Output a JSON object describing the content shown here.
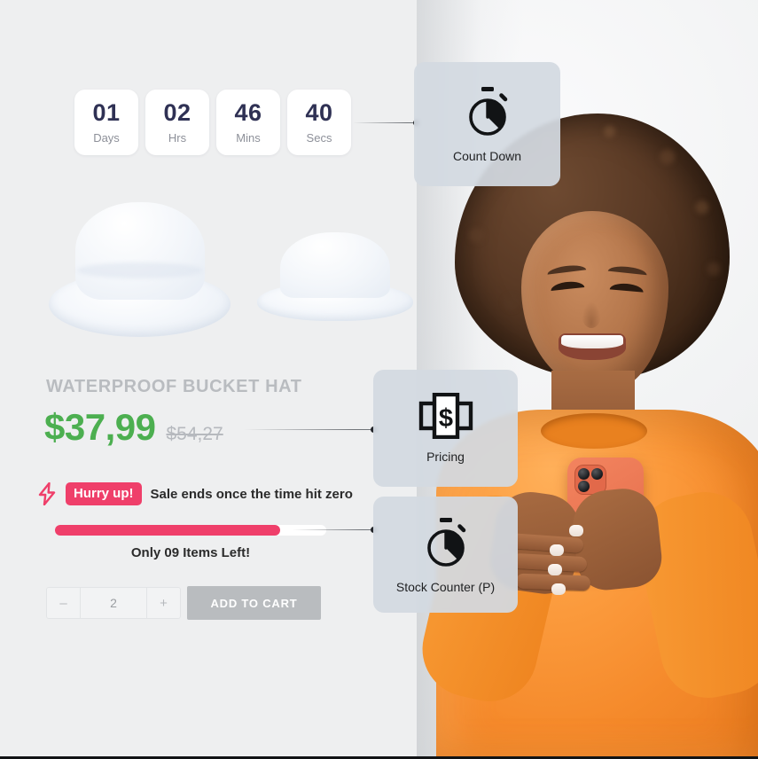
{
  "background_color": "#eeeff0",
  "countdown": {
    "units": [
      {
        "value": "01",
        "label": "Days"
      },
      {
        "value": "02",
        "label": "Hrs"
      },
      {
        "value": "46",
        "label": "Mins"
      },
      {
        "value": "40",
        "label": "Secs"
      }
    ]
  },
  "product": {
    "title": "WATERPROOF BUCKET HAT",
    "sale_price": "$37,99",
    "original_price": "$54,27",
    "sale_price_color": "#4caf50",
    "title_color": "#b9bcc0"
  },
  "urgency": {
    "badge": "Hurry up!",
    "message": "Sale ends once the time hit zero",
    "badge_color": "#ef3f6a",
    "bolt_icon": "lightning-bolt-icon",
    "progress_percent": 83,
    "stock_text": "Only 09 Items Left!"
  },
  "purchase": {
    "decrement_label": "–",
    "quantity": "2",
    "increment_label": "+",
    "add_to_cart_label": "ADD TO CART",
    "add_to_cart_color": "#b9bcbf"
  },
  "annotations": [
    {
      "id": "countdown",
      "label": "Count Down",
      "icon": "stopwatch-icon"
    },
    {
      "id": "pricing",
      "label": "Pricing",
      "icon": "banknote-dollar-icon"
    },
    {
      "id": "stock",
      "label": "Stock Counter (P)",
      "icon": "stopwatch-icon"
    }
  ],
  "photo": {
    "subject": "smiling-woman-holding-phone",
    "sweater_color": "#f58a2b",
    "phone_color": "#ef7a55"
  }
}
